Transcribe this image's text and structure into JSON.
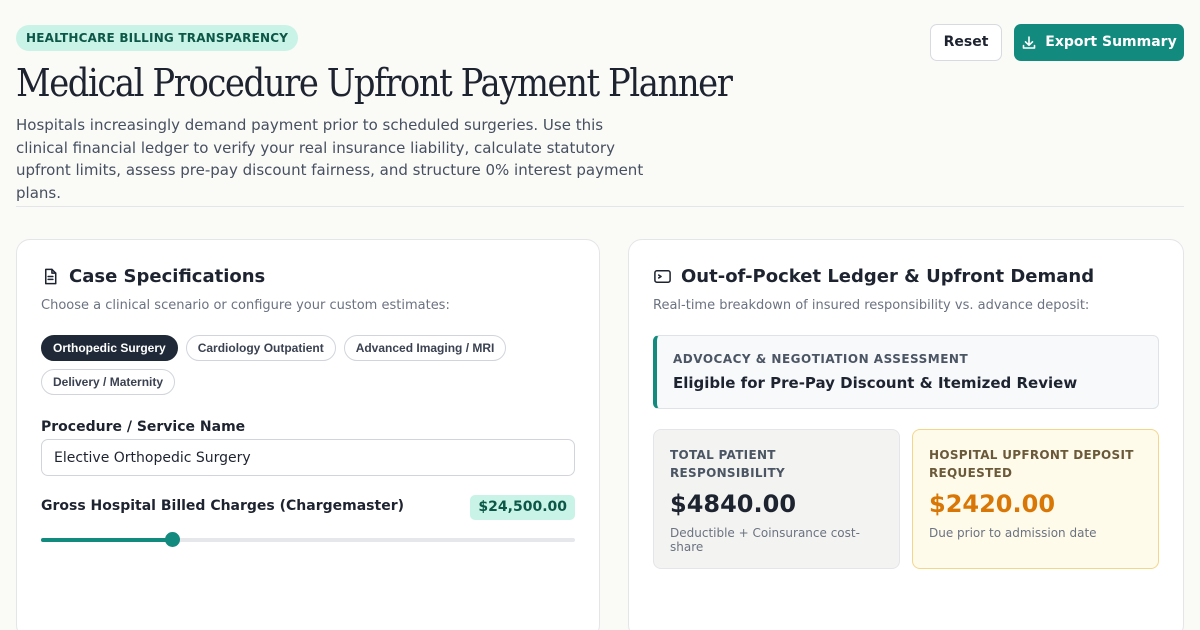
{
  "header": {
    "badge": "HEALTHCARE BILLING TRANSPARENCY",
    "title": "Medical Procedure Upfront Payment Planner",
    "subtitle": "Hospitals increasingly demand payment prior to scheduled surgeries. Use this clinical financial ledger to verify your real insurance liability, calculate statutory upfront limits, assess pre-pay discount fairness, and structure 0% interest payment plans.",
    "reset_label": "Reset",
    "export_label": "Export Summary",
    "export_icon": "download-icon"
  },
  "case_specs": {
    "title": "Case Specifications",
    "icon": "document-icon",
    "subtitle": "Choose a clinical scenario or configure your custom estimates:",
    "scenarios": [
      {
        "label": "Orthopedic Surgery",
        "active": true
      },
      {
        "label": "Cardiology Outpatient",
        "active": false
      },
      {
        "label": "Advanced Imaging / MRI",
        "active": false
      },
      {
        "label": "Delivery / Maternity",
        "active": false
      }
    ],
    "procedure_label": "Procedure / Service Name",
    "procedure_value": "Elective Orthopedic Surgery",
    "charges_label": "Gross Hospital Billed Charges (Chargemaster)",
    "charges_value": "$24,500.00",
    "charges_slider_fraction": 0.245
  },
  "ledger": {
    "title": "Out-of-Pocket Ledger & Upfront Demand",
    "icon": "wallet-icon",
    "subtitle": "Real-time breakdown of insured responsibility vs. advance deposit:",
    "advocacy_label": "ADVOCACY & NEGOTIATION ASSESSMENT",
    "advocacy_value": "Eligible for Pre-Pay Discount & Itemized Review",
    "total_label": "TOTAL PATIENT RESPONSIBILITY",
    "total_amount": "$4840.00",
    "total_note": "Deductible + Coinsurance cost-share",
    "deposit_label": "HOSPITAL UPFRONT DEPOSIT REQUESTED",
    "deposit_amount": "$2420.00",
    "deposit_note": "Due prior to admission date"
  },
  "colors": {
    "accent": "#138a7e",
    "badge_bg": "#c9f3e6",
    "deposit_amount": "#d97706"
  }
}
